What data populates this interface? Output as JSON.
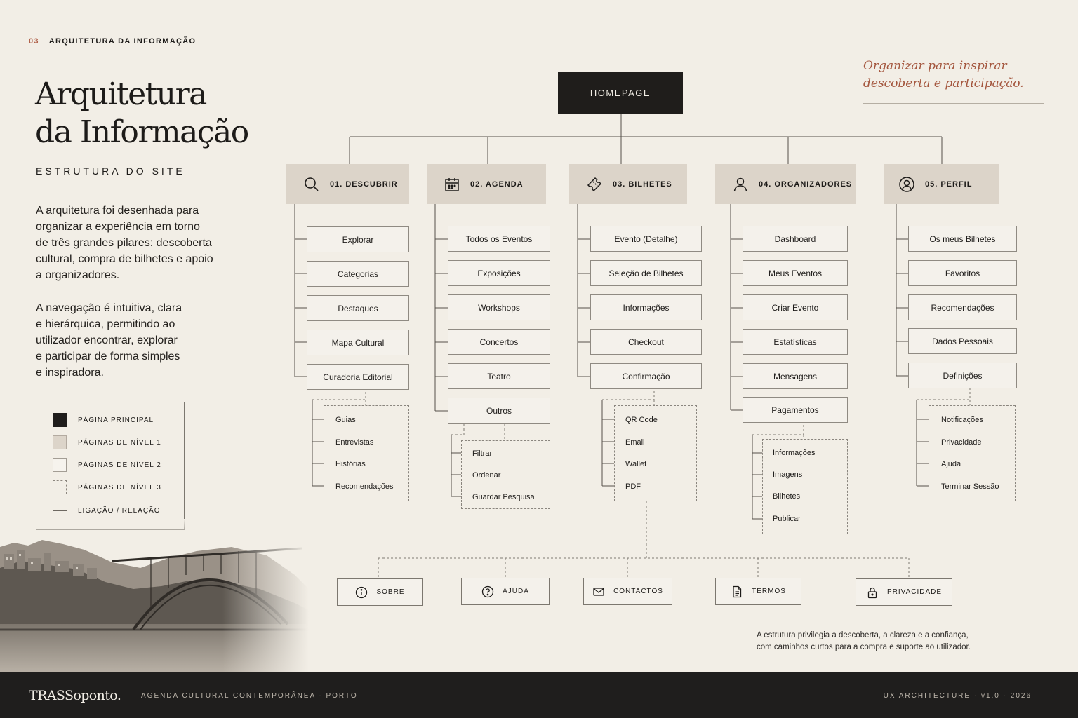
{
  "section": {
    "number": "03",
    "label": "ARQUITETURA DA INFORMAÇÃO"
  },
  "title": {
    "line1": "Arquitetura",
    "line2": "da Informação"
  },
  "subtitle": "ESTRUTURA DO SITE",
  "intro": {
    "p1": [
      "A arquitetura foi desenhada para",
      "organizar a experiência em torno",
      "de três grandes pilares: descoberta",
      "cultural, compra de bilhetes e apoio",
      "a organizadores."
    ],
    "p2": [
      "A navegação é intuitiva, clara",
      "e hierárquica, permitindo ao",
      "utilizador encontrar, explorar",
      "e participar de forma simples",
      "e inspiradora."
    ]
  },
  "legend": {
    "main": "PÁGINA PRINCIPAL",
    "level1": "PÁGINAS DE NÍVEL 1",
    "level2": "PÁGINAS DE NÍVEL 2",
    "level3": "PÁGINAS DE NÍVEL 3",
    "link": "LIGAÇÃO / RELAÇÃO"
  },
  "quote": {
    "line1": "Organizar para inspirar",
    "line2": "descoberta e participação."
  },
  "homepage": "HOMEPAGE",
  "columns": [
    {
      "label": "01. DESCUBRIR",
      "icon": "search-icon",
      "pages": [
        "Explorar",
        "Categorias",
        "Destaques",
        "Mapa Cultural",
        "Curadoria Editorial"
      ],
      "sub": [
        "Guias",
        "Entrevistas",
        "Histórias",
        "Recomendações"
      ]
    },
    {
      "label": "02. AGENDA",
      "icon": "calendar-icon",
      "pages": [
        "Todos os Eventos",
        "Exposições",
        "Workshops",
        "Concertos",
        "Teatro",
        "Outros"
      ],
      "sub": [
        "Filtrar",
        "Ordenar",
        "Guardar Pesquisa"
      ]
    },
    {
      "label": "03. BILHETES",
      "icon": "ticket-icon",
      "pages": [
        "Evento (Detalhe)",
        "Seleção de Bilhetes",
        "Informações",
        "Checkout",
        "Confirmação"
      ],
      "sub": [
        "QR Code",
        "Email",
        "Wallet",
        "PDF"
      ]
    },
    {
      "label": "04. ORGANIZADORES",
      "icon": "user-icon",
      "pages": [
        "Dashboard",
        "Meus Eventos",
        "Criar Evento",
        "Estatísticas",
        "Mensagens",
        "Pagamentos"
      ],
      "sub": [
        "Informações",
        "Imagens",
        "Bilhetes",
        "Publicar"
      ]
    },
    {
      "label": "05. PERFIL",
      "icon": "profile-icon",
      "pages": [
        "Os meus Bilhetes",
        "Favoritos",
        "Recomendações",
        "Dados Pessoais",
        "Definições"
      ],
      "sub": [
        "Notificações",
        "Privacidade",
        "Ajuda",
        "Terminar Sessão"
      ]
    }
  ],
  "utility": [
    {
      "label": "SOBRE",
      "icon": "info-icon"
    },
    {
      "label": "AJUDA",
      "icon": "help-icon"
    },
    {
      "label": "CONTACTOS",
      "icon": "mail-icon"
    },
    {
      "label": "TERMOS",
      "icon": "document-icon"
    },
    {
      "label": "PRIVACIDADE",
      "icon": "lock-icon"
    }
  ],
  "note": {
    "line1": "A estrutura privilegia a descoberta, a clareza e a confiança,",
    "line2": "com caminhos curtos para a compra e suporte ao utilizador."
  },
  "footer": {
    "brand": "TRASSoponto.",
    "tagline": "AGENDA CULTURAL CONTEMPORÂNEA  ·  PORTO",
    "meta": "UX ARCHITECTURE  ·  v1.0  ·  2026"
  },
  "colors": {
    "background": "#f2eee6",
    "dark": "#1f1d1b",
    "level1": "#dcd4c9",
    "accent": "#a4563e"
  }
}
